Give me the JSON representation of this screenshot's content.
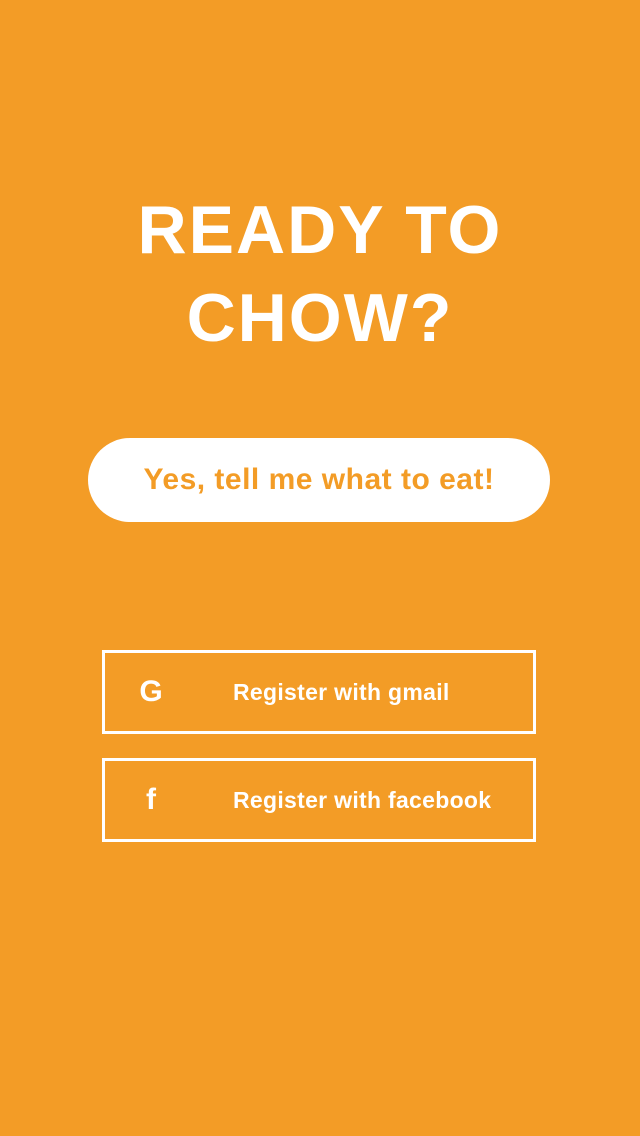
{
  "colors": {
    "background": "#F39C26",
    "foreground": "#FFFFFF"
  },
  "headline": {
    "line1": "READY TO",
    "line2": "CHOW?"
  },
  "cta": {
    "label": "Yes, tell me what to eat!"
  },
  "register": {
    "gmail": {
      "icon": "google-icon",
      "icon_glyph": "G",
      "label": "Register with gmail"
    },
    "facebook": {
      "icon": "facebook-icon",
      "icon_glyph": "f",
      "label": "Register with facebook"
    }
  }
}
